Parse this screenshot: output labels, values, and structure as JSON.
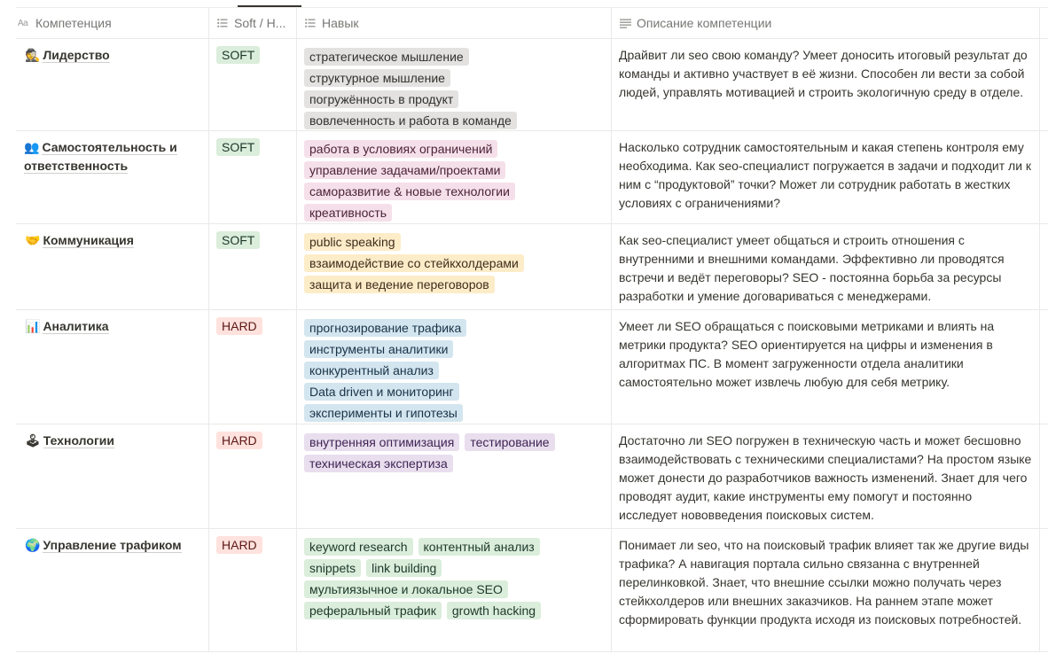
{
  "header": {
    "col_name": "Компетенция",
    "col_type": "Soft / H...",
    "col_skills": "Навык",
    "col_desc": "Описание компетенции"
  },
  "rows": [
    {
      "emoji": "🕵",
      "name": "Лидерство",
      "type": "SOFT",
      "skills": [
        "стратегическое мышление",
        "структурное мышление",
        "погружённость в продукт",
        "вовлеченность и работа в команде"
      ],
      "description": "Драйвит ли seo свою команду? Умеет доносить итоговый результат до команды и активно участвует в её жизни. Способен ли вести за собой людей, управлять мотивацией и строить экологичную среду в отделе."
    },
    {
      "emoji": "👥",
      "name": "Самостоятельность и ответственность",
      "type": "SOFT",
      "skills": [
        "работа в условиях ограничений",
        "управление задачами/проектами",
        "саморазвитие & новые технологии",
        "креативность"
      ],
      "description": "Насколько сотрудник самостоятельным и какая степень контроля ему необходима. Как seo-специалист погружается в задачи и подходит ли к ним с “продуктовой” точки? Может ли сотрудник работать в жестких условиях с ограничениями?"
    },
    {
      "emoji": "🤝",
      "name": "Коммуникация",
      "type": "SOFT",
      "skills": [
        "public speaking",
        "взаимодействие со стейкхолдерами",
        "защита и ведение переговоров"
      ],
      "description": "Как seo-специалист умеет общаться и строить отношения с внутренними и внешними командами. Эффективно ли проводятся встречи и ведёт переговоры? SEO - постоянна борьба за ресурсы разработки и умение договариваться с менеджерами."
    },
    {
      "emoji": "📊",
      "name": "Аналитика",
      "type": "HARD",
      "skills": [
        "прогнозирование трафика",
        "инструменты аналитики",
        "конкурентный анализ",
        "Data driven и мониторинг",
        "эксперименты и гипотезы"
      ],
      "description": "Умеет ли SEO обращаться с поисковыми метриками и влиять на метрики продукта? SEO ориентируется на цифры и изменения в алгоритмах ПС. В момент загруженности отдела аналитики самостоятельно может извлечь любую для себя метрику."
    },
    {
      "emoji": "🕹",
      "name": "Технологии",
      "type": "HARD",
      "skills": [
        "внутренняя оптимизация",
        "тестирование",
        "техническая экспертиза"
      ],
      "description": "Достаточно ли SEO погружен в техническую часть и может бесшовно взаимодействовать с техническими специалистами? На простом языке может донести до разработчиков важность изменений. Знает для чего проводят аудит, какие инструменты ему помогут и постоянно исследует нововведения поисковых систем."
    },
    {
      "emoji": "🌍",
      "name": "Управление трафиком",
      "type": "HARD",
      "skills": [
        "keyword research",
        "контентный анализ",
        "snippets",
        "link building",
        "мультиязычное и локальное SEO",
        "реферальный трафик",
        "growth hacking"
      ],
      "description": "Понимает ли seo, что на поисковый трафик влияет так же другие виды трафика? А навигация портала сильно связанна с внутренней перелинковкой. Знает, что внешние ссылки можно получать через стейкхолдеров или внешних заказчиков. На раннем этапе может сформировать функции продукта исходя из поисковых потребностей."
    }
  ]
}
